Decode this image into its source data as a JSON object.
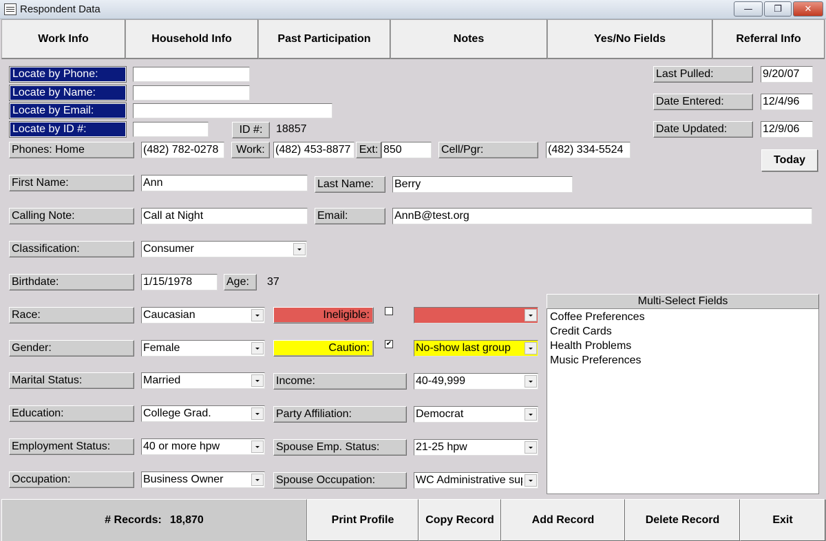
{
  "window": {
    "title": "Respondent Data",
    "min_glyph": "—",
    "max_glyph": "❐",
    "close_glyph": "✕"
  },
  "tabs": [
    "Work Info",
    "Household Info",
    "Past Participation",
    "Notes",
    "Yes/No Fields",
    "Referral Info"
  ],
  "locate": {
    "phone_label": "Locate by Phone:",
    "name_label": "Locate by Name:",
    "email_label": "Locate by Email:",
    "id_label": "Locate by ID #:",
    "phone_value": "",
    "name_value": "",
    "email_value": "",
    "id_value": ""
  },
  "id": {
    "label": "ID #:",
    "value": "18857"
  },
  "dates": {
    "last_pulled_label": "Last Pulled:",
    "last_pulled": "9/20/07",
    "date_entered_label": "Date Entered:",
    "date_entered": "12/4/96",
    "date_updated_label": "Date Updated:",
    "date_updated": "12/9/06",
    "today_button": "Today"
  },
  "phones": {
    "home_label": "Phones: Home",
    "home": "(482) 782-0278",
    "work_label": "Work:",
    "work": "(482) 453-8877",
    "ext_label": "Ext:",
    "ext": "850",
    "cell_label": "Cell/Pgr:",
    "cell": "(482) 334-5524"
  },
  "person": {
    "first_name_label": "First Name:",
    "first_name": "Ann",
    "last_name_label": "Last Name:",
    "last_name": "Berry",
    "calling_note_label": "Calling Note:",
    "calling_note": "Call at Night",
    "email_label": "Email:",
    "email": "AnnB@test.org",
    "classification_label": "Classification:",
    "classification": "Consumer",
    "birthdate_label": "Birthdate:",
    "birthdate": "1/15/1978",
    "age_label": "Age:",
    "age": "37"
  },
  "demographics": {
    "race_label": "Race:",
    "race": "Caucasian",
    "gender_label": "Gender:",
    "gender": "Female",
    "marital_label": "Marital Status:",
    "marital": "Married",
    "education_label": "Education:",
    "education": "College Grad.",
    "employment_label": "Employment Status:",
    "employment": "40 or more hpw",
    "occupation_label": "Occupation:",
    "occupation": "Business Owner"
  },
  "flags": {
    "ineligible_label": "Ineligible:",
    "ineligible_checked": false,
    "ineligible_value": "",
    "caution_label": "Caution:",
    "caution_checked": true,
    "caution_value": "No-show last group",
    "ineligible_color": "#e15a55",
    "caution_color": "#ffff00"
  },
  "household": {
    "income_label": "Income:",
    "income": "40-49,999",
    "party_label": "Party Affiliation:",
    "party": "Democrat",
    "spouse_emp_label": "Spouse Emp. Status:",
    "spouse_emp": "21-25 hpw",
    "spouse_occ_label": "Spouse Occupation:",
    "spouse_occ": "WC Administrative support"
  },
  "multi_select": {
    "title": "Multi-Select Fields",
    "items": [
      "Coffee Preferences",
      "Credit Cards",
      "Health Problems",
      "Music Preferences"
    ]
  },
  "footer": {
    "records_label": "# Records:",
    "records_count": "18,870",
    "print_profile": "Print Profile",
    "copy_record": "Copy Record",
    "add_record": "Add Record",
    "delete_record": "Delete Record",
    "exit": "Exit"
  },
  "colors": {
    "locate_bg": "#0a1a7d",
    "form_bg": "#d7d3d7"
  }
}
